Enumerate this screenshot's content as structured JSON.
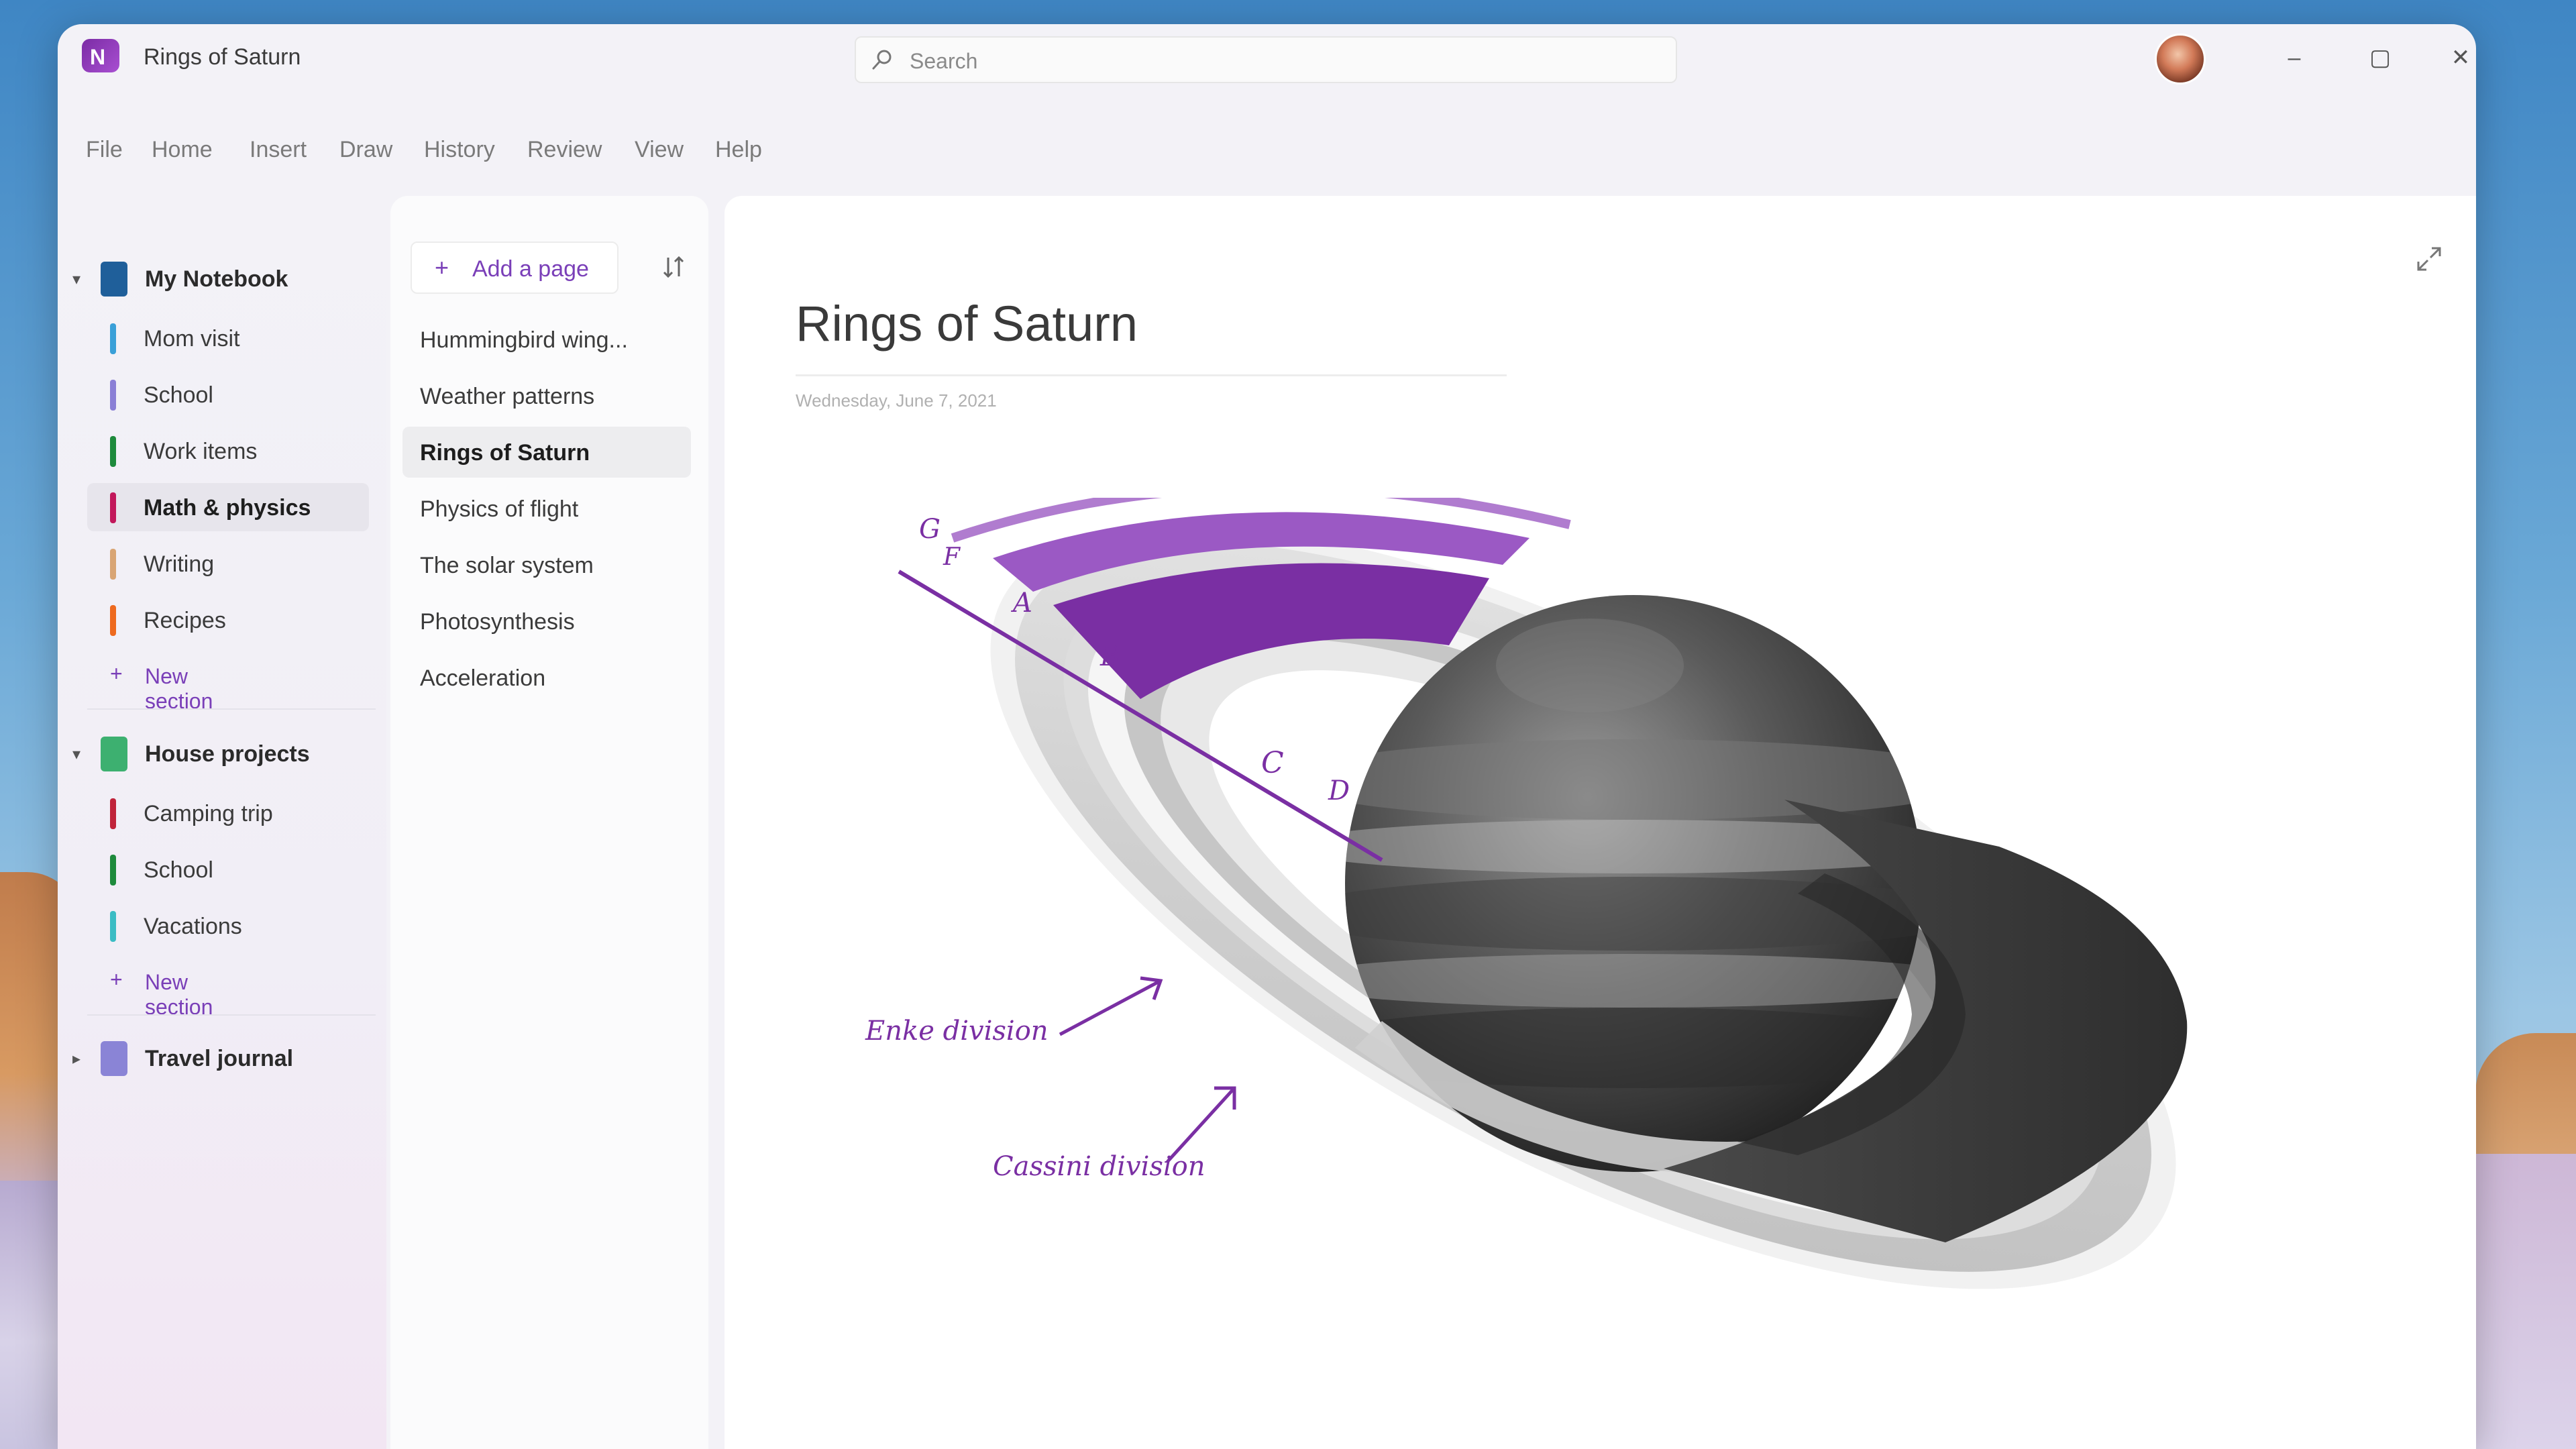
{
  "window": {
    "title": "Rings of Saturn",
    "search_placeholder": "Search",
    "controls": {
      "minimize": "–",
      "maximize": "▢",
      "close": "✕"
    }
  },
  "menu": [
    "File",
    "Home",
    "Insert",
    "Draw",
    "History",
    "Review",
    "View",
    "Help"
  ],
  "notebooks": [
    {
      "name": "My Notebook",
      "expanded": true,
      "color": "#1f5f9a",
      "sections": [
        {
          "label": "Mom visit",
          "color": "#3aa0d8"
        },
        {
          "label": "School",
          "color": "#8a7fd6"
        },
        {
          "label": "Work items",
          "color": "#1e8a3c"
        },
        {
          "label": "Math & physics",
          "color": "#c2185b",
          "active": true
        },
        {
          "label": "Writing",
          "color": "#d9a574"
        },
        {
          "label": "Recipes",
          "color": "#ee6a1f"
        }
      ],
      "new_section": "New section"
    },
    {
      "name": "House projects",
      "expanded": true,
      "color": "#3db070",
      "sections": [
        {
          "label": "Camping trip",
          "color": "#c0243a"
        },
        {
          "label": "School",
          "color": "#1e8a3c"
        },
        {
          "label": "Vacations",
          "color": "#3bbcc4"
        }
      ],
      "new_section": "New section"
    },
    {
      "name": "Travel journal",
      "expanded": false,
      "color": "#8a84d6"
    }
  ],
  "pages": {
    "add_label": "Add a page",
    "items": [
      {
        "label": "Hummingbird wing..."
      },
      {
        "label": "Weather patterns"
      },
      {
        "label": "Rings of Saturn",
        "active": true
      },
      {
        "label": "Physics of flight"
      },
      {
        "label": "The solar system"
      },
      {
        "label": "Photosynthesis"
      },
      {
        "label": "Acceleration"
      }
    ]
  },
  "note": {
    "title": "Rings of Saturn",
    "date": "Wednesday, June 7, 2021",
    "ink_labels": {
      "g": "G",
      "f": "F",
      "a": "A",
      "b": "B",
      "c": "C",
      "d": "D",
      "encke": "Enke division",
      "cassini": "Cassini division"
    },
    "accent_color": "#7a2fa3"
  }
}
